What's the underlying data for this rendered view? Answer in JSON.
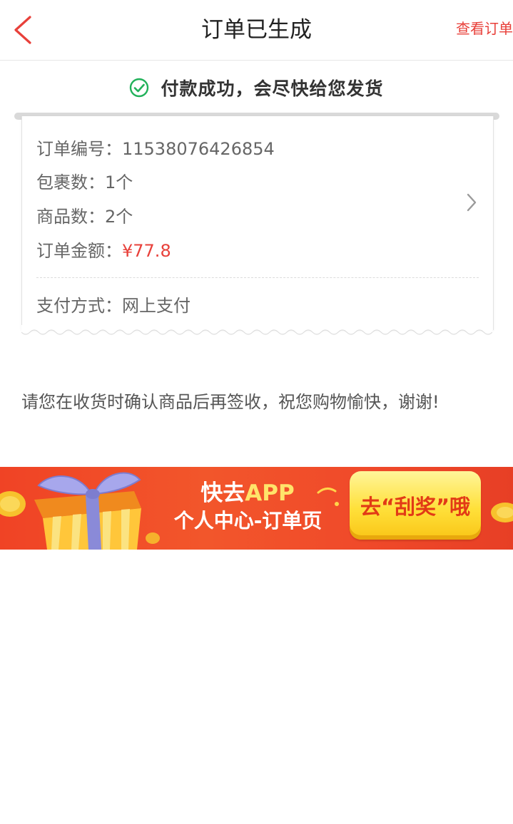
{
  "navbar": {
    "back_icon": "chevron-left-icon",
    "title": "订单已生成",
    "right_link": "查看订单",
    "accent_color": "#e8403a"
  },
  "status": {
    "icon": "check-circle-icon",
    "text": "付款成功，会尽快给您发货",
    "icon_color": "#21b15a"
  },
  "order": {
    "number_label": "订单编号：",
    "number_value": "11538076426854",
    "packages_label": "包裹数：",
    "packages_value": "1个",
    "items_label": "商品数：",
    "items_value": "2个",
    "amount_label": "订单金额：",
    "amount_value": "¥77.8",
    "payment_label": "支付方式：",
    "payment_value": "网上支付",
    "detail_icon": "chevron-right-icon"
  },
  "notice": "请您在收货时确认商品后再签收，祝您购物愉快，谢谢!",
  "banner": {
    "line1_prefix": "快去",
    "line1_highlight": "APP",
    "line2": "个人中心-订单页",
    "button_label": "去“刮奖”哦",
    "gift_icon": "gift-box-icon"
  }
}
